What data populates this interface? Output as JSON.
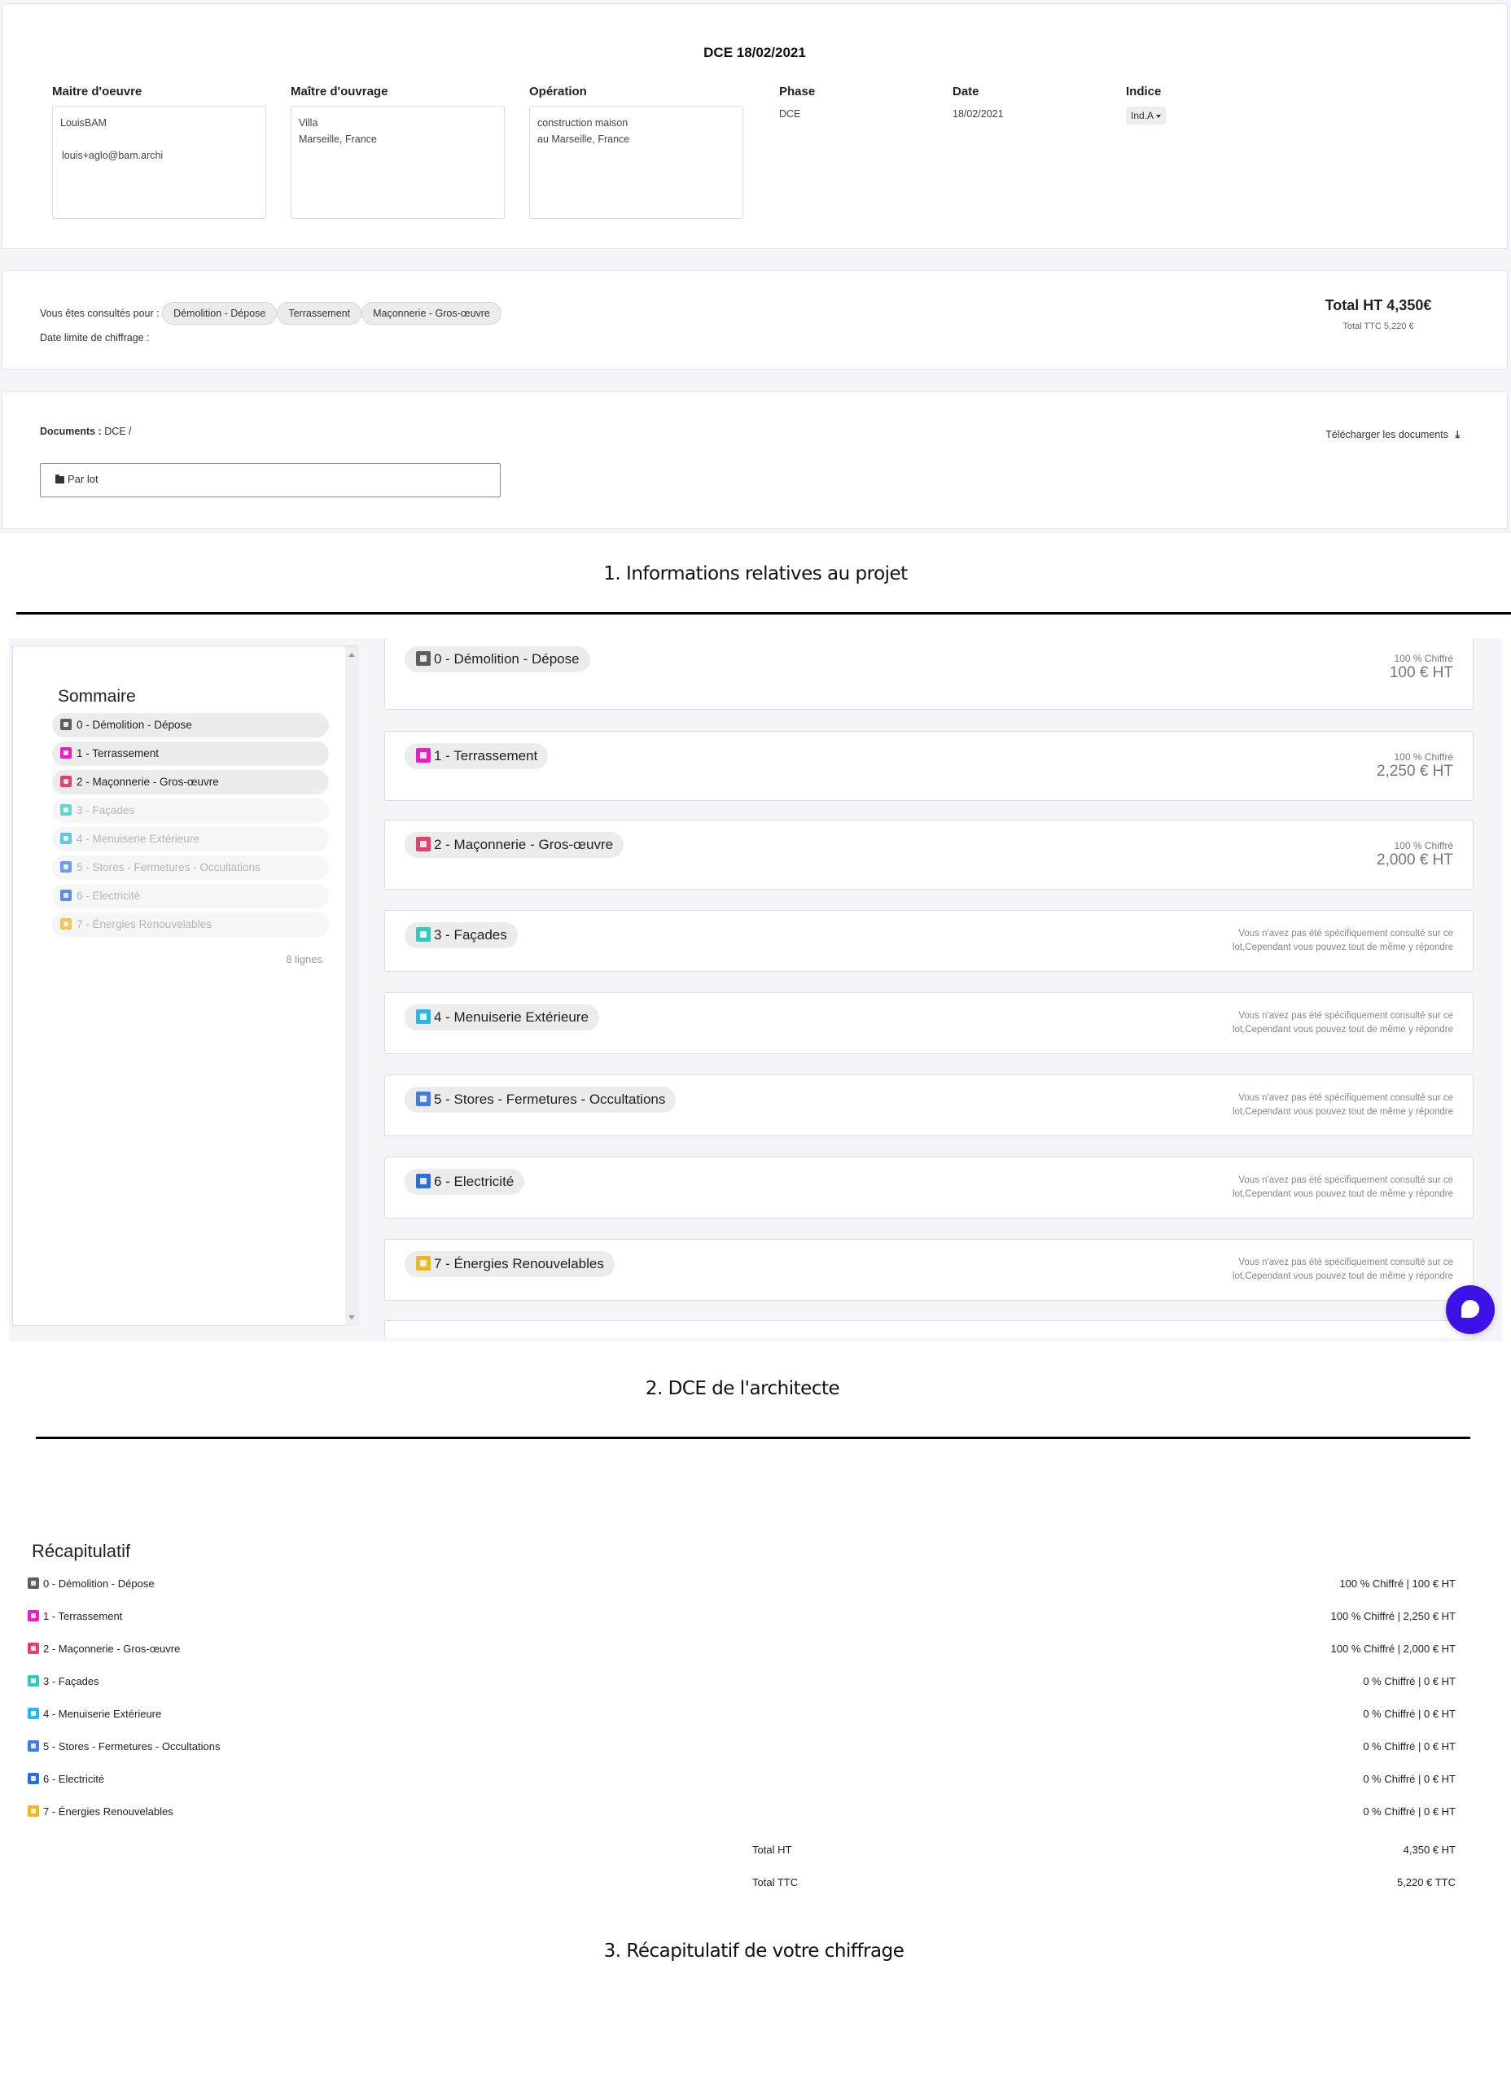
{
  "project": {
    "title": "DCE 18/02/2021",
    "maitre_oeuvre": {
      "label": "Maitre d'oeuvre",
      "name": "LouisBAM",
      "email": "louis+aglo@bam.archi"
    },
    "maitre_ouvrage": {
      "label": "Maître d'ouvrage",
      "line1": "Villa",
      "line2": "Marseille, France"
    },
    "operation": {
      "label": "Opération",
      "line1": "construction maison",
      "line2": "au Marseille, France"
    },
    "phase": {
      "label": "Phase",
      "value": "DCE"
    },
    "date": {
      "label": "Date",
      "value": "18/02/2021"
    },
    "indice": {
      "label": "Indice",
      "value": "Ind.A"
    }
  },
  "consultation": {
    "label": "Vous êtes consultés pour :",
    "lots": [
      "Démolition - Dépose",
      "Terrassement",
      "Maçonnerie - Gros-œuvre"
    ],
    "deadline_label": "Date limite de chiffrage :",
    "total_ht": "Total HT 4,350€",
    "total_ttc": "Total TTC 5,220 €"
  },
  "documents": {
    "label": "Documents :",
    "path": "DCE /",
    "download_label": "Télécharger les documents",
    "select_value": "Par lot"
  },
  "captions": {
    "section1": "1. Informations relatives au projet",
    "section2": "2. DCE  de l'architecte",
    "section3": "3. Récapitulatif de votre chiffrage"
  },
  "sommaire": {
    "title": "Sommaire",
    "count": "8 lignes",
    "items": [
      {
        "label": "0 - Démolition - Dépose",
        "color": "#5f5f5f",
        "active": true
      },
      {
        "label": "1 - Terrassement",
        "color": "#e91ec6",
        "active": true
      },
      {
        "label": "2 - Maçonnerie - Gros-œuvre",
        "color": "#e2416b",
        "active": true
      },
      {
        "label": "3 - Façades",
        "color": "#35c9bd",
        "active": false
      },
      {
        "label": "4 - Menuiserie Extérieure",
        "color": "#2bb7ea",
        "active": false
      },
      {
        "label": "5 - Stores - Fermetures - Occultations",
        "color": "#3f7fe0",
        "active": false
      },
      {
        "label": "6 - Electricité",
        "color": "#2a6fe0",
        "active": false
      },
      {
        "label": "7 - Énergies Renouvelables",
        "color": "#f2b71e",
        "active": false
      }
    ]
  },
  "lots": [
    {
      "label": "0 - Démolition - Dépose",
      "pct": "100 % Chiffré",
      "amount": "100 € HT"
    },
    {
      "label": "1 - Terrassement",
      "pct": "100 % Chiffré",
      "amount": "2,250 € HT"
    },
    {
      "label": "2 - Maçonnerie - Gros-œuvre",
      "pct": "100 % Chiffré",
      "amount": "2,000 € HT"
    },
    {
      "label": "3 - Façades",
      "note1": "Vous n'avez pas été spécifiquement consulté sur ce",
      "note2": "lot,Cependant vous pouvez tout de même y répondre"
    },
    {
      "label": "4 - Menuiserie Extérieure",
      "note1": "Vous n'avez pas été spécifiquement consulté sur ce",
      "note2": "lot,Cependant vous pouvez tout de même y répondre"
    },
    {
      "label": "5 - Stores - Fermetures - Occultations",
      "note1": "Vous n'avez pas été spécifiquement consulté sur ce",
      "note2": "lot,Cependant vous pouvez tout de même y répondre"
    },
    {
      "label": "6 - Electricité",
      "note1": "Vous n'avez pas été spécifiquement consulté sur ce",
      "note2": "lot,Cependant vous pouvez tout de même y répondre"
    },
    {
      "label": "7 - Énergies Renouvelables",
      "note1": "Vous n'avez pas été spécifiquement consulté sur ce",
      "note2": "lot,Cependant vous pouvez tout de même y répondre"
    }
  ],
  "recap": {
    "title": "Récapitulatif",
    "rows": [
      {
        "label": "0 - Démolition - Dépose",
        "value": "100 % Chiffré | 100 € HT"
      },
      {
        "label": "1 - Terrassement",
        "value": "100 % Chiffré | 2,250 € HT"
      },
      {
        "label": "2 - Maçonnerie - Gros-œuvre",
        "value": "100 % Chiffré | 2,000 € HT"
      },
      {
        "label": "3 - Façades",
        "value": "0 % Chiffré | 0 € HT"
      },
      {
        "label": "4 - Menuiserie Extérieure",
        "value": "0 % Chiffré | 0 € HT"
      },
      {
        "label": "5 - Stores - Fermetures - Occultations",
        "value": "0 % Chiffré | 0 € HT"
      },
      {
        "label": "6 - Electricité",
        "value": "0 % Chiffré | 0 € HT"
      },
      {
        "label": "7 - Énergies Renouvelables",
        "value": "0 % Chiffré | 0 € HT"
      }
    ],
    "total_ht_label": "Total HT",
    "total_ht_value": "4,350 € HT",
    "total_ttc_label": "Total TTC",
    "total_ttc_value": "5,220 € TTC"
  }
}
